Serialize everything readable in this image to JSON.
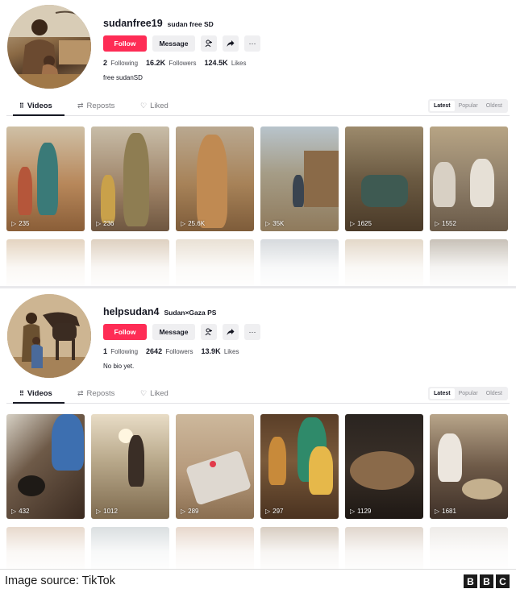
{
  "profiles": [
    {
      "username": "sudanfree19",
      "nickname": "sudan free SD",
      "follow_label": "Follow",
      "message_label": "Message",
      "following_count": "2",
      "following_label": "Following",
      "followers_count": "16.2K",
      "followers_label": "Followers",
      "likes_count": "124.5K",
      "likes_label": "Likes",
      "bio": "free sudanSD",
      "tabs": [
        "Videos",
        "Reposts",
        "Liked"
      ],
      "sort_options": [
        "Latest",
        "Popular",
        "Oldest"
      ],
      "videos": [
        {
          "views": "235",
          "bg": "#b7875a"
        },
        {
          "views": "236",
          "bg": "#9c8064"
        },
        {
          "views": "25.6K",
          "bg": "#a78258"
        },
        {
          "views": "35K",
          "bg": "#8f8a7c"
        },
        {
          "views": "1625",
          "bg": "#6b5a42"
        },
        {
          "views": "1552",
          "bg": "#8d7d68"
        }
      ]
    },
    {
      "username": "helpsudan4",
      "nickname": "Sudan×Gaza PS",
      "follow_label": "Follow",
      "message_label": "Message",
      "following_count": "1",
      "following_label": "Following",
      "followers_count": "2642",
      "followers_label": "Followers",
      "likes_count": "13.9K",
      "likes_label": "Likes",
      "bio": "No bio yet.",
      "tabs": [
        "Videos",
        "Reposts",
        "Liked"
      ],
      "sort_options": [
        "Latest",
        "Popular",
        "Oldest"
      ],
      "videos": [
        {
          "views": "432",
          "bg": "#4a3a30"
        },
        {
          "views": "1012",
          "bg": "#a89a80"
        },
        {
          "views": "289",
          "bg": "#b69a7c"
        },
        {
          "views": "297",
          "bg": "#7a5a3a"
        },
        {
          "views": "1129",
          "bg": "#3a3028"
        },
        {
          "views": "1681",
          "bg": "#6e5a48"
        }
      ]
    }
  ],
  "footer": {
    "source": "Image source: TikTok",
    "logo": [
      "B",
      "B",
      "C"
    ]
  },
  "icons": {
    "add_friend": "person-plus-icon",
    "share": "share-arrow-icon",
    "more": "ellipsis-icon",
    "views": "play-icon",
    "videos_tab": "grid-icon",
    "reposts_tab": "repost-icon",
    "liked_tab": "heart-icon"
  },
  "colors": {
    "follow_button": "#fe2c55",
    "secondary_button": "#efeff1",
    "text_primary": "#161823"
  }
}
